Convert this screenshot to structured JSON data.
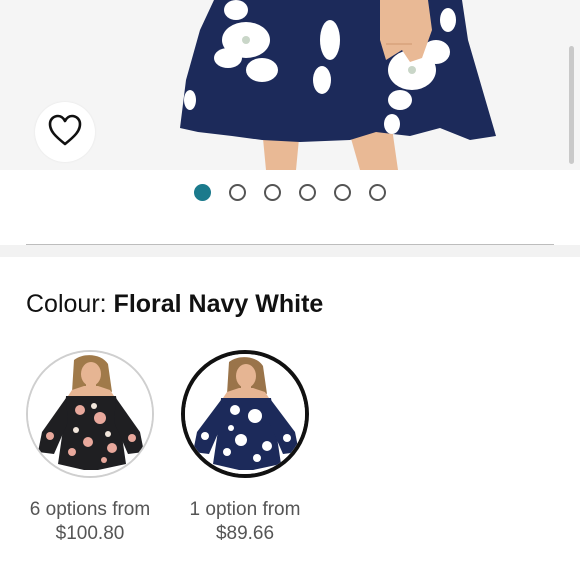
{
  "gallery": {
    "image_count": 6,
    "active_index": 0,
    "accent_color": "#1b7a8c"
  },
  "favorite": {
    "icon": "heart-outline-icon"
  },
  "colour": {
    "label": "Colour:",
    "value": "Floral Navy White"
  },
  "options": [
    {
      "count_text": "6 options from",
      "price": "$100.80",
      "selected": false,
      "variant": "Floral Black"
    },
    {
      "count_text": "1 option from",
      "price": "$89.66",
      "selected": true,
      "variant": "Floral Navy White"
    }
  ]
}
